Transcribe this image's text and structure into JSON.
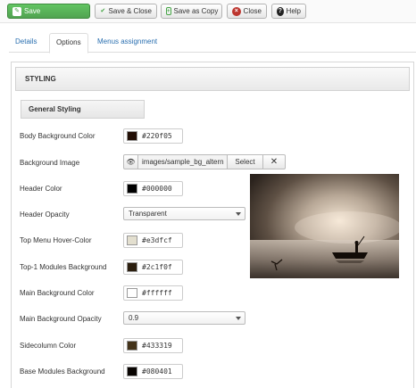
{
  "toolbar": {
    "save_label": "Save",
    "save_close_label": "Save & Close",
    "save_copy_label": "Save as Copy",
    "close_label": "Close",
    "help_label": "Help"
  },
  "tabs": [
    {
      "label": "Details",
      "active": false
    },
    {
      "label": "Options",
      "active": true
    },
    {
      "label": "Menus assignment",
      "active": false
    }
  ],
  "panel": {
    "title": "STYLING",
    "subsection": "General Styling"
  },
  "fields": {
    "body_bg": {
      "label": "Body Background Color",
      "value": "#220f05",
      "swatch": "#220f05"
    },
    "bg_image": {
      "label": "Background Image",
      "value": "images/sample_bg_altern",
      "select_label": "Select",
      "clear_label": "✕"
    },
    "header_color": {
      "label": "Header Color",
      "value": "#000000",
      "swatch": "#000000"
    },
    "header_opacity": {
      "label": "Header Opacity",
      "value": "Transparent"
    },
    "top_menu_hover": {
      "label": "Top Menu Hover-Color",
      "value": "#e3dfcf",
      "swatch": "#e3dfcf"
    },
    "top1_modules_bg": {
      "label": "Top-1 Modules Background",
      "value": "#2c1f0f",
      "swatch": "#2c1f0f"
    },
    "main_bg": {
      "label": "Main Background Color",
      "value": "#ffffff",
      "swatch": "#ffffff"
    },
    "main_bg_opacity": {
      "label": "Main Background Opacity",
      "value": "0.9"
    },
    "sidecolumn": {
      "label": "Sidecolumn Color",
      "value": "#433319",
      "swatch": "#433319"
    },
    "base_modules_bg": {
      "label": "Base Modules Background",
      "value": "#080401",
      "swatch": "#080401"
    }
  },
  "colors": {
    "save_button": "#51a351",
    "tab_link": "#2a6fb0"
  }
}
